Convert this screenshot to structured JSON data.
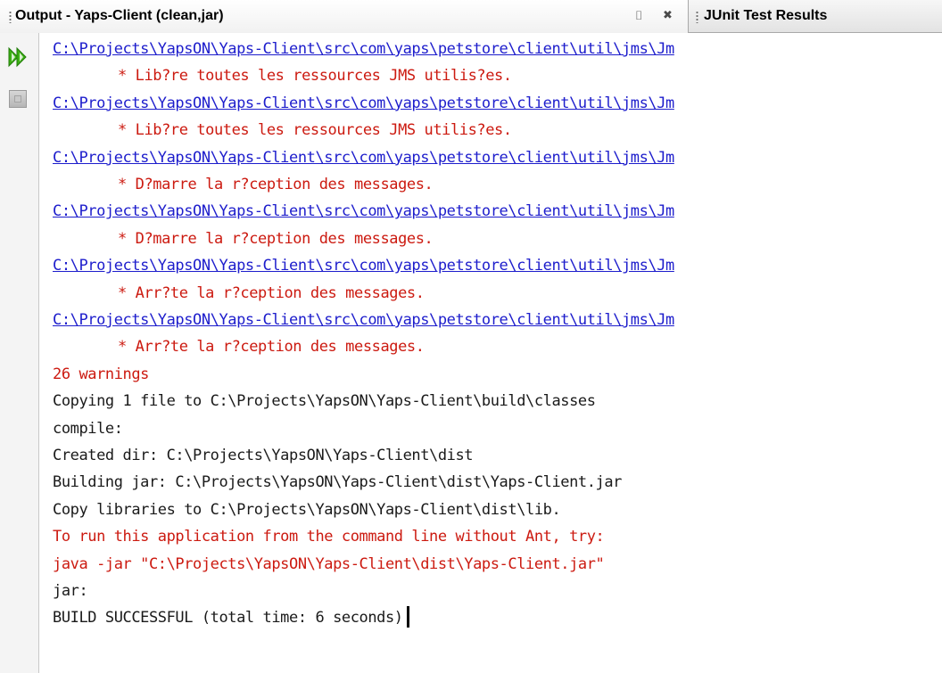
{
  "tabs": {
    "output_label": "Output - Yaps-Client (clean,jar)",
    "junit_label": "JUnit Test Results"
  },
  "icons": {
    "minimize": "minimize-window-icon",
    "close": "close-tab-icon",
    "rerun": "rerun-icon",
    "stop": "stop-icon"
  },
  "colors": {
    "link": "#1d1dcc",
    "warning": "#cc1a10",
    "normal": "#1a1a1a",
    "rerun_green": "#3cb014"
  },
  "output": {
    "lines": [
      {
        "text": "C:\\Projects\\YapsON\\Yaps-Client\\src\\com\\yaps\\petstore\\client\\util\\jms\\Jm",
        "type": "link"
      },
      {
        "text": "* Lib?re toutes les ressources JMS utilis?es.",
        "type": "warn_indent"
      },
      {
        "text": "C:\\Projects\\YapsON\\Yaps-Client\\src\\com\\yaps\\petstore\\client\\util\\jms\\Jm",
        "type": "link"
      },
      {
        "text": "* Lib?re toutes les ressources JMS utilis?es.",
        "type": "warn_indent"
      },
      {
        "text": "C:\\Projects\\YapsON\\Yaps-Client\\src\\com\\yaps\\petstore\\client\\util\\jms\\Jm",
        "type": "link"
      },
      {
        "text": "* D?marre la r?ception des messages.",
        "type": "warn_indent"
      },
      {
        "text": "C:\\Projects\\YapsON\\Yaps-Client\\src\\com\\yaps\\petstore\\client\\util\\jms\\Jm",
        "type": "link"
      },
      {
        "text": "* D?marre la r?ception des messages.",
        "type": "warn_indent"
      },
      {
        "text": "C:\\Projects\\YapsON\\Yaps-Client\\src\\com\\yaps\\petstore\\client\\util\\jms\\Jm",
        "type": "link"
      },
      {
        "text": "* Arr?te la r?ception des messages.",
        "type": "warn_indent"
      },
      {
        "text": "C:\\Projects\\YapsON\\Yaps-Client\\src\\com\\yaps\\petstore\\client\\util\\jms\\Jm",
        "type": "link"
      },
      {
        "text": "* Arr?te la r?ception des messages.",
        "type": "warn_indent"
      },
      {
        "text": "26 warnings",
        "type": "warn"
      },
      {
        "text": "Copying 1 file to C:\\Projects\\YapsON\\Yaps-Client\\build\\classes",
        "type": "normal"
      },
      {
        "text": "compile:",
        "type": "normal"
      },
      {
        "text": "Created dir: C:\\Projects\\YapsON\\Yaps-Client\\dist",
        "type": "normal"
      },
      {
        "text": "Building jar: C:\\Projects\\YapsON\\Yaps-Client\\dist\\Yaps-Client.jar",
        "type": "normal"
      },
      {
        "text": "Copy libraries to C:\\Projects\\YapsON\\Yaps-Client\\dist\\lib.",
        "type": "normal"
      },
      {
        "text": "To run this application from the command line without Ant, try:",
        "type": "warn"
      },
      {
        "text": "java -jar \"C:\\Projects\\YapsON\\Yaps-Client\\dist\\Yaps-Client.jar\"",
        "type": "warn"
      },
      {
        "text": "jar:",
        "type": "normal"
      },
      {
        "text": "BUILD SUCCESSFUL (total time: 6 seconds)",
        "type": "normal",
        "caret": true
      }
    ]
  }
}
